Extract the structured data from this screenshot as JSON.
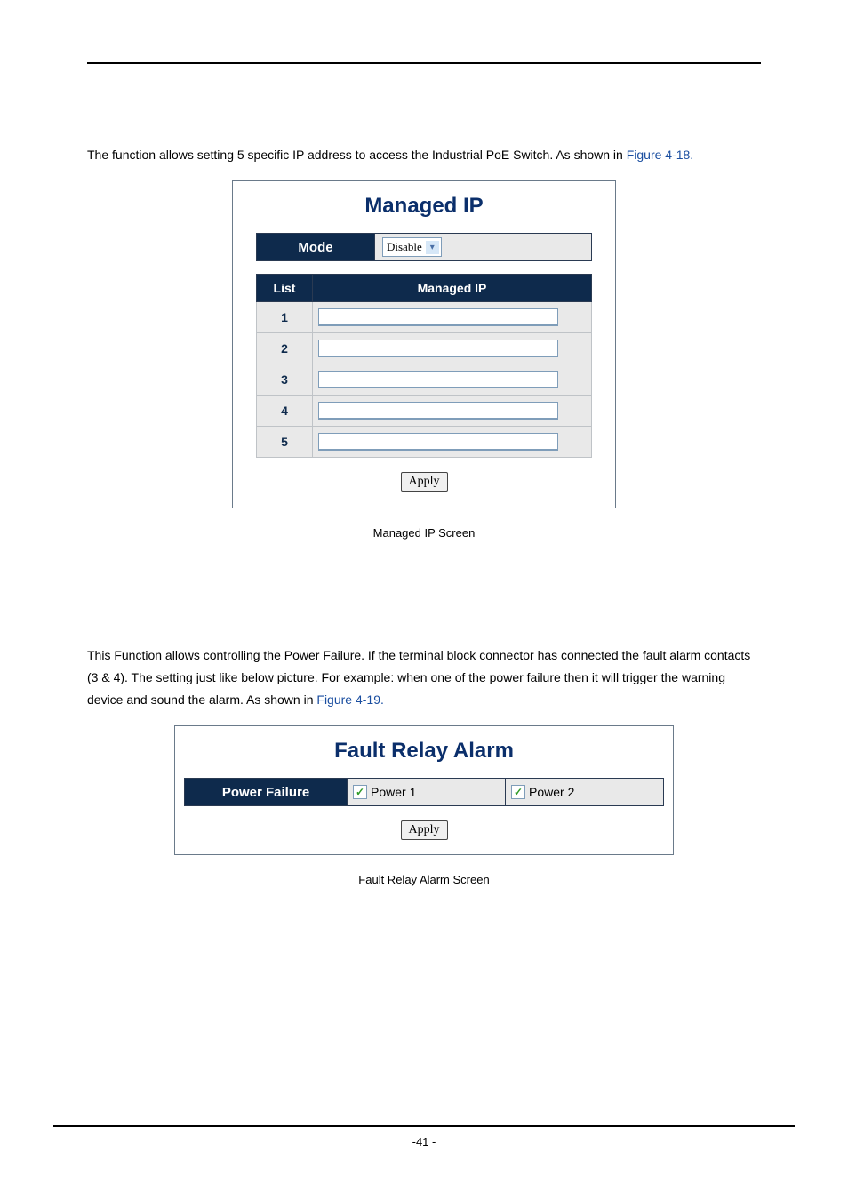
{
  "intro1_a": "The function allows setting 5 specific IP address to access the Industrial PoE Switch. As shown in ",
  "intro1_link": "Figure 4-18.",
  "panel1": {
    "title": "Managed IP",
    "mode_label": "Mode",
    "mode_value": "Disable",
    "headers": {
      "list": "List",
      "ip": "Managed IP"
    },
    "rows": [
      "1",
      "2",
      "3",
      "4",
      "5"
    ],
    "apply": "Apply"
  },
  "caption1": "Managed IP Screen",
  "intro2_a": "This Function allows controlling the Power Failure. If the terminal block connector has connected the fault alarm contacts (3 & 4). The setting just like below picture. For example: when one of the power failure then it will trigger the warning device and sound the alarm. As shown in ",
  "intro2_link": "Figure 4-19.",
  "panel2": {
    "title": "Fault Relay Alarm",
    "row_label": "Power Failure",
    "opt1": "Power 1",
    "opt2": "Power 2",
    "apply": "Apply"
  },
  "caption2": "Fault Relay Alarm Screen",
  "page_number": "-41 -"
}
